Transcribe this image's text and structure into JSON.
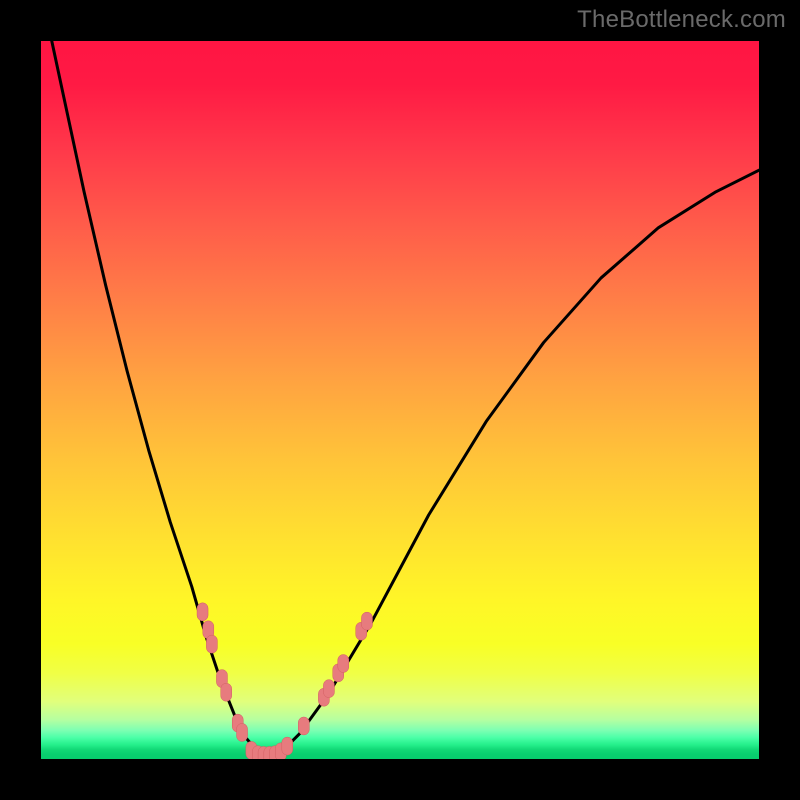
{
  "watermark": "TheBottleneck.com",
  "colors": {
    "page_bg": "#000000",
    "curve": "#000000",
    "marker_fill": "#e77b7e",
    "marker_stroke": "#d35f62"
  },
  "chart_data": {
    "type": "line",
    "title": "",
    "xlabel": "",
    "ylabel": "",
    "xlim": [
      0,
      100
    ],
    "ylim": [
      0,
      100
    ],
    "grid": false,
    "legend": false,
    "series": [
      {
        "name": "bottleneck-curve",
        "x": [
          0,
          3,
          6,
          9,
          12,
          15,
          18,
          21,
          23,
          25,
          27,
          28.5,
          30,
          31,
          32,
          34,
          36,
          40,
          46,
          54,
          62,
          70,
          78,
          86,
          94,
          100
        ],
        "y": [
          107,
          93,
          79,
          66,
          54,
          43,
          33,
          24,
          17,
          11,
          6,
          3,
          1.2,
          0.6,
          0.6,
          1.5,
          3.5,
          9,
          19,
          34,
          47,
          58,
          67,
          74,
          79,
          82
        ]
      }
    ],
    "markers": [
      {
        "x": 22.5,
        "y": 20.5
      },
      {
        "x": 23.3,
        "y": 18.0
      },
      {
        "x": 23.8,
        "y": 16.0
      },
      {
        "x": 25.2,
        "y": 11.2
      },
      {
        "x": 25.8,
        "y": 9.3
      },
      {
        "x": 27.4,
        "y": 5.0
      },
      {
        "x": 28.0,
        "y": 3.7
      },
      {
        "x": 29.3,
        "y": 1.2
      },
      {
        "x": 30.2,
        "y": 0.6
      },
      {
        "x": 31.0,
        "y": 0.5
      },
      {
        "x": 31.8,
        "y": 0.5
      },
      {
        "x": 32.6,
        "y": 0.6
      },
      {
        "x": 33.4,
        "y": 1.0
      },
      {
        "x": 34.3,
        "y": 1.8
      },
      {
        "x": 36.6,
        "y": 4.6
      },
      {
        "x": 39.4,
        "y": 8.6
      },
      {
        "x": 40.1,
        "y": 9.8
      },
      {
        "x": 41.4,
        "y": 12.0
      },
      {
        "x": 42.1,
        "y": 13.3
      },
      {
        "x": 44.6,
        "y": 17.8
      },
      {
        "x": 45.4,
        "y": 19.2
      }
    ]
  }
}
